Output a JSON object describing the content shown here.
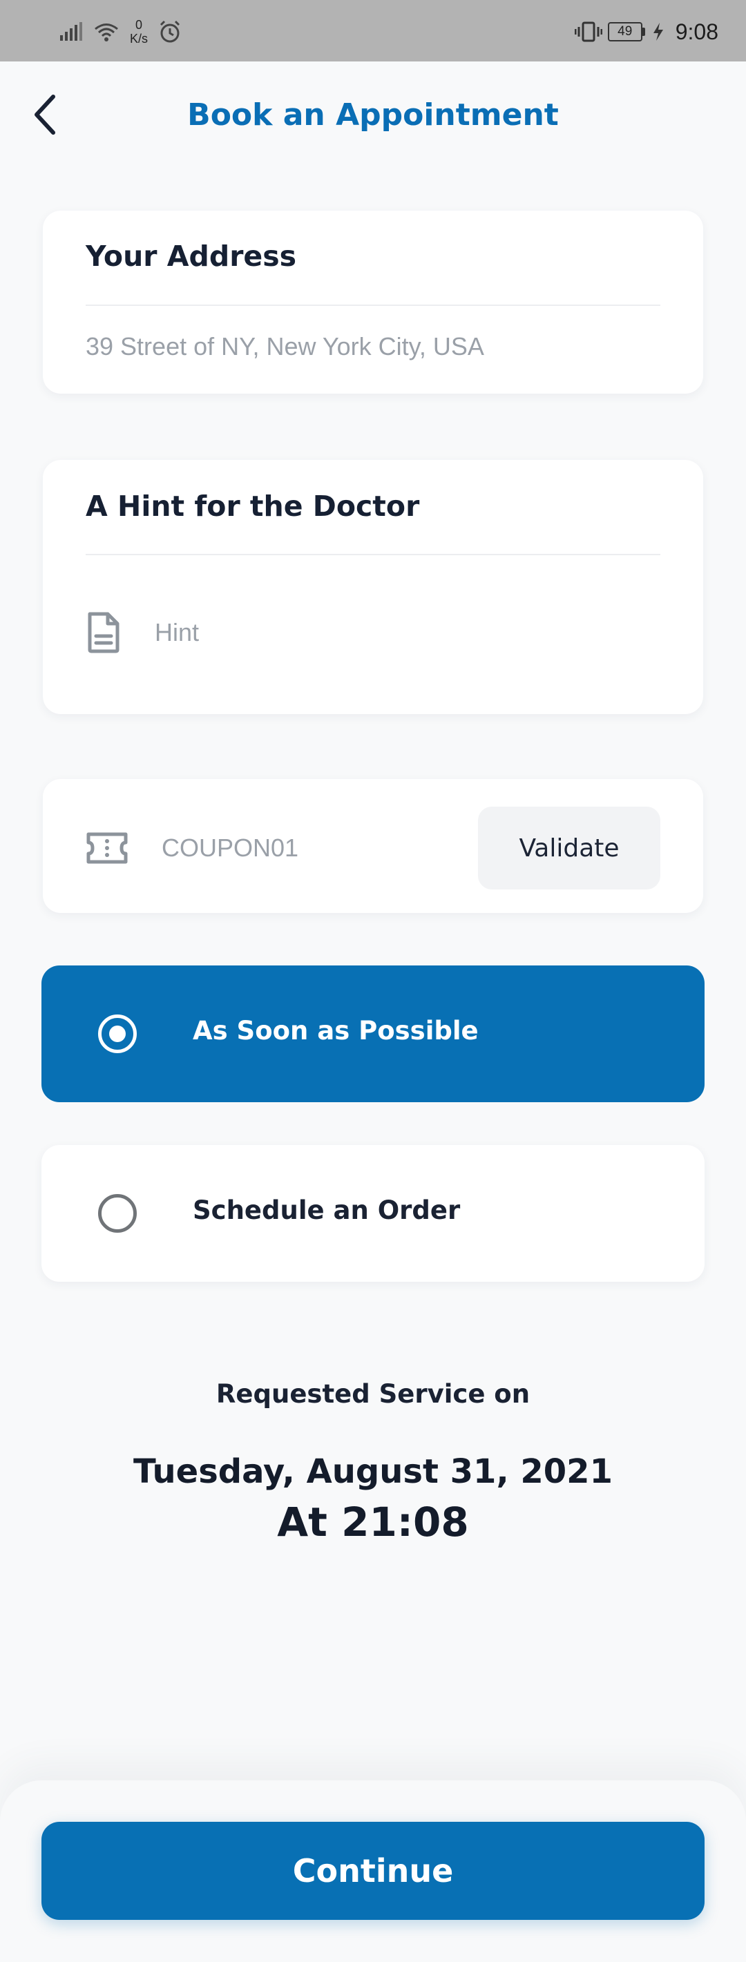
{
  "status_bar": {
    "net_speed_value": "0",
    "net_speed_unit": "K/s",
    "battery_level": "49",
    "time": "9:08"
  },
  "header": {
    "title": "Book an Appointment"
  },
  "address_card": {
    "title": "Your Address",
    "address": "39 Street of NY, New York City, USA"
  },
  "hint_card": {
    "title": "A Hint for the Doctor",
    "placeholder": "Hint"
  },
  "coupon_card": {
    "placeholder": "COUPON01",
    "validate_label": "Validate"
  },
  "timing_options": [
    {
      "label": "As Soon as Possible",
      "selected": true
    },
    {
      "label": "Schedule an Order",
      "selected": false
    }
  ],
  "requested_service": {
    "caption": "Requested Service on",
    "date": "Tuesday, August 31, 2021",
    "time": "At 21:08"
  },
  "footer": {
    "continue_label": "Continue"
  },
  "colors": {
    "primary": "#0870b4",
    "title_blue": "#0a6eb5",
    "background": "#f8f9fa",
    "card": "#ffffff",
    "muted_text": "#9aa0a8",
    "dark_text": "#1a2233"
  }
}
